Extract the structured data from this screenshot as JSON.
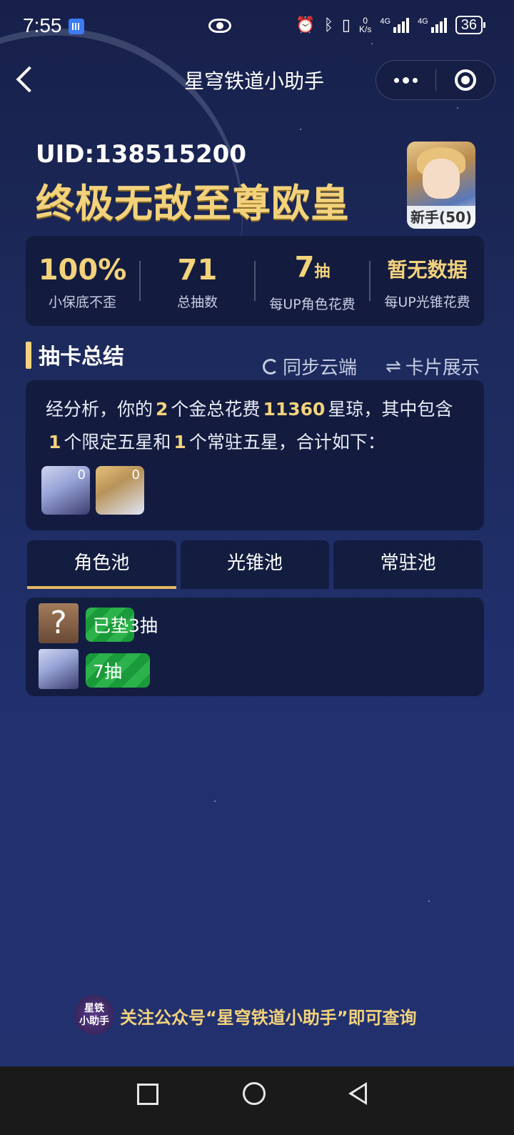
{
  "status_bar": {
    "time": "7:55",
    "net_speed_value": "0",
    "net_speed_unit": "K/s",
    "signal_1": "4G",
    "signal_2": "4G",
    "battery": "36"
  },
  "nav": {
    "title": "星穹铁道小助手"
  },
  "profile": {
    "uid": "UID:138515200",
    "rank_title": "终极无敌至尊欧皇",
    "avatar_badge": "新手(50)"
  },
  "stats": [
    {
      "value": "100%",
      "unit": "",
      "label": "小保底不歪"
    },
    {
      "value": "71",
      "unit": "",
      "label": "总抽数"
    },
    {
      "value": "7",
      "unit": "抽",
      "label": "每UP角色花费"
    },
    {
      "value": "暂无数据",
      "unit": "",
      "label": "每UP光锥花费"
    }
  ],
  "section": {
    "title": "抽卡总结",
    "sync_label": "同步云端",
    "card_label": "卡片展示"
  },
  "summary": {
    "part1": "经分析，你的",
    "gold_count": "2",
    "part2": "个金总花费",
    "total_cost": "11360",
    "part3": "星琼，其中包含",
    "limited_count": "1",
    "part4": "个限定五星和",
    "standard_count": "1",
    "part5": "个常驻五星，合计如下：",
    "thumbs": [
      {
        "count": "0"
      },
      {
        "count": "0"
      }
    ]
  },
  "tabs": [
    {
      "label": "角色池",
      "active": true
    },
    {
      "label": "光锥池",
      "active": false
    },
    {
      "label": "常驻池",
      "active": false
    }
  ],
  "records": [
    {
      "avatar_glyph": "?",
      "label": "已垫3抽",
      "bar_color": "#2cb24b"
    },
    {
      "label": "7抽",
      "bar_color": "#2cb24b"
    }
  ],
  "footer": {
    "logo_line1": "星铁",
    "logo_line2": "小助手",
    "text": "关注公众号“星穹铁道小助手”即可查询"
  },
  "colors": {
    "accent_gold": "#f3d27c",
    "panel_bg": "#121a3a",
    "tab_underline": "#e5b85f"
  }
}
